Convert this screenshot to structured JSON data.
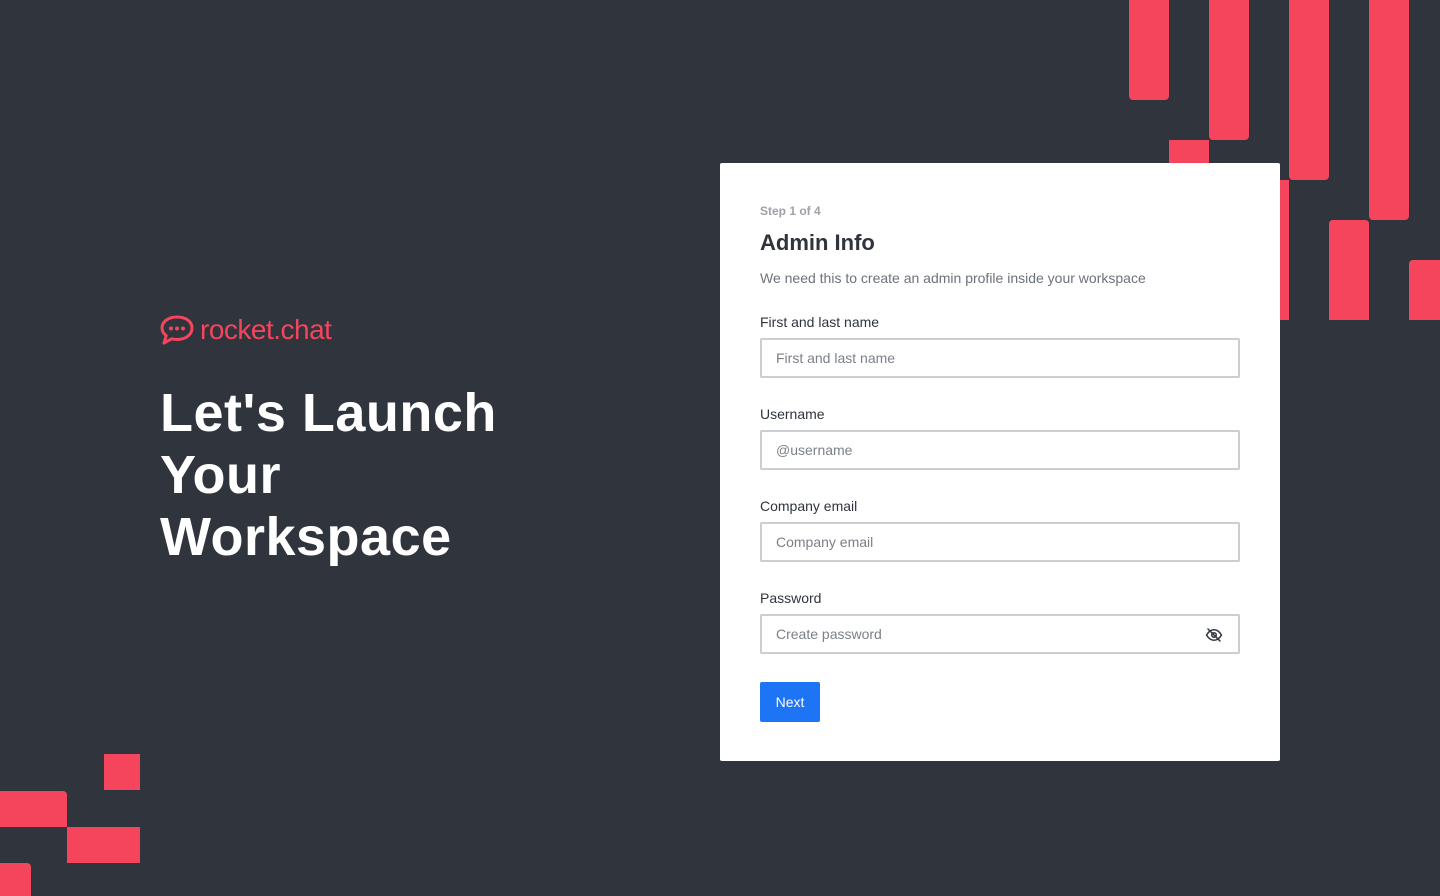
{
  "brand": {
    "name": "rocket.chat",
    "color": "#f5455c",
    "logo_icon": "rocket-chat-logo-icon"
  },
  "headline": {
    "text": "Let's Launch Your Workspace"
  },
  "form": {
    "step": "Step 1 of 4",
    "title": "Admin Info",
    "subtitle": "We need this to create an admin profile inside your workspace",
    "fields": [
      {
        "label": "First and last name",
        "placeholder": "First and last name",
        "value": ""
      },
      {
        "label": "Username",
        "placeholder": "@username",
        "value": ""
      },
      {
        "label": "Company email",
        "placeholder": "Company email",
        "value": ""
      },
      {
        "label": "Password",
        "placeholder": "Create password",
        "value": ""
      }
    ],
    "password_toggle_icon": "eye-off-icon",
    "next_label": "Next"
  },
  "colors": {
    "background": "#2f343d",
    "accent": "#f5455c",
    "primary_button": "#1d74f5",
    "card": "#ffffff"
  }
}
